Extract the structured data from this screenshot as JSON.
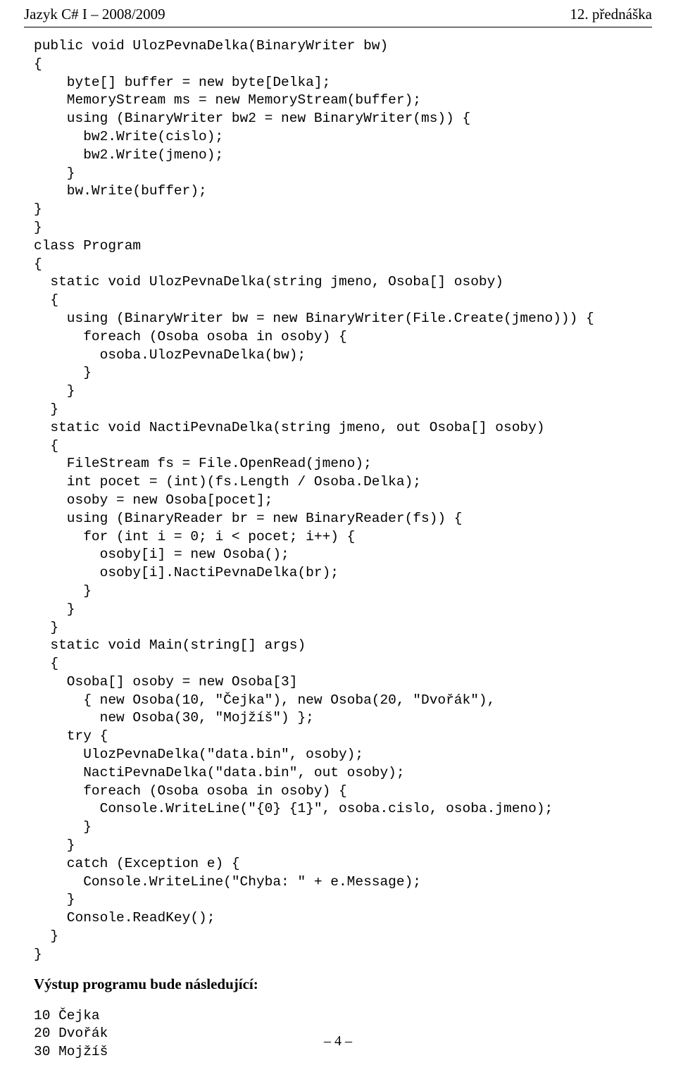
{
  "header": {
    "left": "Jazyk C# I – 2008/2009",
    "right": "12. přednáška"
  },
  "code_lines": [
    "public void UlozPevnaDelka(BinaryWriter bw)",
    "{",
    "    byte[] buffer = new byte[Delka];",
    "    MemoryStream ms = new MemoryStream(buffer);",
    "    using (BinaryWriter bw2 = new BinaryWriter(ms)) {",
    "      bw2.Write(cislo);",
    "      bw2.Write(jmeno);",
    "    }",
    "    bw.Write(buffer);",
    "}",
    "}",
    "class Program",
    "{",
    "  static void UlozPevnaDelka(string jmeno, Osoba[] osoby)",
    "  {",
    "    using (BinaryWriter bw = new BinaryWriter(File.Create(jmeno))) {",
    "      foreach (Osoba osoba in osoby) {",
    "        osoba.UlozPevnaDelka(bw);",
    "      }",
    "    }",
    "  }",
    "  static void NactiPevnaDelka(string jmeno, out Osoba[] osoby)",
    "  {",
    "    FileStream fs = File.OpenRead(jmeno);",
    "    int pocet = (int)(fs.Length / Osoba.Delka);",
    "    osoby = new Osoba[pocet];",
    "    using (BinaryReader br = new BinaryReader(fs)) {",
    "      for (int i = 0; i < pocet; i++) {",
    "        osoby[i] = new Osoba();",
    "        osoby[i].NactiPevnaDelka(br);",
    "      }",
    "    }",
    "  }",
    "  static void Main(string[] args)",
    "  {",
    "    Osoba[] osoby = new Osoba[3]",
    "      { new Osoba(10, \"Čejka\"), new Osoba(20, \"Dvořák\"),",
    "        new Osoba(30, \"Mojžíš\") };",
    "    try {",
    "      UlozPevnaDelka(\"data.bin\", osoby);",
    "      NactiPevnaDelka(\"data.bin\", out osoby);",
    "      foreach (Osoba osoba in osoby) {",
    "        Console.WriteLine(\"{0} {1}\", osoba.cislo, osoba.jmeno);",
    "      }",
    "    }",
    "    catch (Exception e) {",
    "      Console.WriteLine(\"Chyba: \" + e.Message);",
    "    }",
    "    Console.ReadKey();",
    "  }",
    "}"
  ],
  "caption": "Výstup programu bude následující:",
  "output_lines": [
    "10 Čejka",
    "20 Dvořák",
    "30 Mojžíš"
  ],
  "footer": "– 4 –"
}
